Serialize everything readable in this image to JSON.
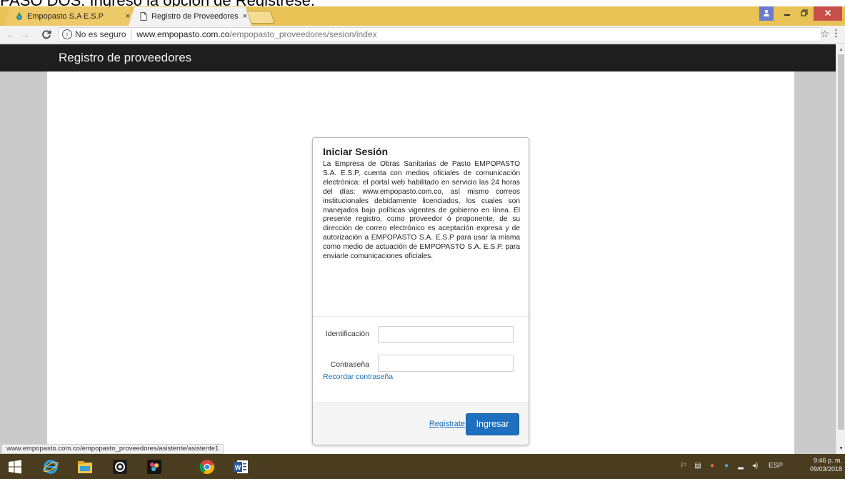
{
  "caption": "PASO DOS: Ingreso la opción de Registrese.",
  "browser": {
    "tabs": [
      {
        "title": "Empopasto S.A E.S.P",
        "close": "×"
      },
      {
        "title": "Registro de Proveedores",
        "close": "×"
      }
    ],
    "security_label": "No es seguro",
    "url_host": "www.empopasto.com.co",
    "url_path": "/empopasto_proveedores/sesion/index",
    "status_url": "www.empopasto.com.co/empopasto_proveedores/asistente/asistente1"
  },
  "page": {
    "brand": "Registro de proveedores"
  },
  "login": {
    "title": "Iniciar Sesión",
    "description": "La Empresa de Obras Sanitarias de Pasto EMPOPASTO S.A. E.S.P, cuenta con medios oficiales de comunicación electrónica: el portal web habilitado en servicio las 24 horas del días: www.empopasto.com.co, así mismo correos institucionales debidamente licenciados, los cuales son manejados bajo políticas vigentes de gobierno en línea. El presente registro, como proveedor ó proponente, de su dirección de correo electrónico es aceptación expresa y de autorización a EMPOPASTO S.A. E.S.P para usar la misma como medio de actuación de EMPOPASTO S.A. E.S.P. para enviarle comunicaciones oficiales.",
    "id_label": "Identificación",
    "id_value": "",
    "password_label": "Contraseña",
    "password_value": "",
    "recover_link": "Recordar contraseña",
    "register_link": "Registrate",
    "submit_label": "Ingresar"
  },
  "taskbar": {
    "language": "ESP",
    "time": "9:46 p. m.",
    "date": "09/03/2018"
  },
  "colors": {
    "navbar": "#1e1e1e",
    "primary_button": "#1f6fbf",
    "link": "#1b6fb8",
    "titlebar": "#e8c255",
    "taskbar": "#4a3d1f"
  }
}
